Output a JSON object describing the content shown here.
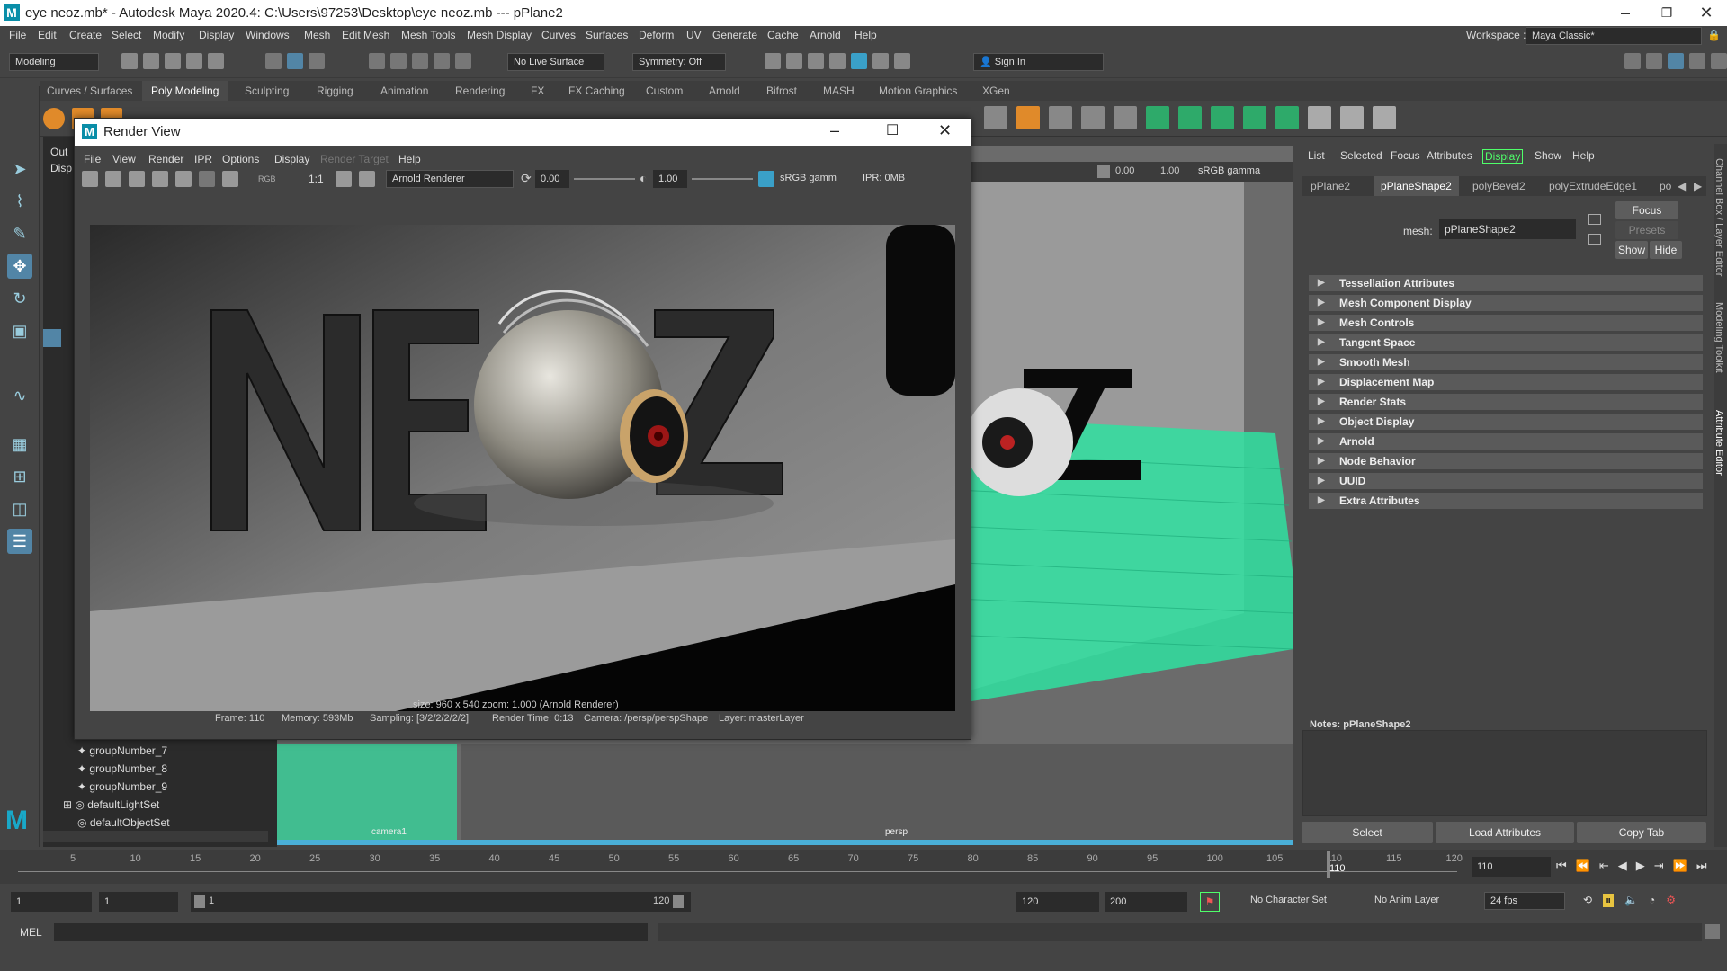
{
  "window": {
    "title": "eye neoz.mb* - Autodesk Maya 2020.4: C:\\Users\\97253\\Desktop\\eye neoz.mb   ---   pPlane2",
    "logo": "M"
  },
  "menubar": [
    "File",
    "Edit",
    "Create",
    "Select",
    "Modify",
    "Display",
    "Windows",
    "Mesh",
    "Edit Mesh",
    "Mesh Tools",
    "Mesh Display",
    "Curves",
    "Surfaces",
    "Deform",
    "UV",
    "Generate",
    "Cache",
    "Arnold",
    "Help"
  ],
  "workspace": {
    "label": "Workspace :",
    "value": "Maya Classic*"
  },
  "status": {
    "menuset": "Modeling",
    "live_surface": "No Live Surface",
    "symmetry": "Symmetry: Off",
    "sign_in": "Sign In"
  },
  "shelf_tabs": [
    "Curves / Surfaces",
    "Poly Modeling",
    "Sculpting",
    "Rigging",
    "Animation",
    "Rendering",
    "FX",
    "FX Caching",
    "Custom",
    "Arnold",
    "Bifrost",
    "MASH",
    "Motion Graphics",
    "XGen"
  ],
  "shelf_active": "Poly Modeling",
  "outliner": {
    "partial": [
      "Out",
      "Disp"
    ],
    "items": [
      "groupNumber_7",
      "groupNumber_8",
      "groupNumber_9",
      "defaultLightSet",
      "defaultObjectSet"
    ]
  },
  "viewport": {
    "exposure": "0.00",
    "gamma": "1.00",
    "colorspace": "sRGB gamma",
    "panes": [
      "camera1",
      "persp"
    ]
  },
  "render_view": {
    "title": "Render View",
    "menus": [
      "File",
      "View",
      "Render",
      "IPR",
      "Options",
      "Display",
      "Render Target",
      "Help"
    ],
    "ratio": "1:1",
    "renderer": "Arnold Renderer",
    "exposure": "0.00",
    "gamma": "1.00",
    "colorspace": "sRGB gamm",
    "ipr": "IPR: 0MB",
    "rgb": "RGB",
    "size_line": "size: 960 x 540  zoom: 1.000     (Arnold Renderer)",
    "stats": [
      "Frame: 110",
      "Memory: 593Mb",
      "Sampling: [3/2/2/2/2/2]",
      "Render Time: 0:13",
      "Camera: /persp/perspShape",
      "Layer: masterLayer"
    ],
    "text_letters": [
      "N",
      "E",
      "O",
      "Z"
    ]
  },
  "attribute_editor": {
    "menu": [
      "List",
      "Selected",
      "Focus",
      "Attributes",
      "Display",
      "Show",
      "Help"
    ],
    "tabs": [
      "pPlane2",
      "pPlaneShape2",
      "polyBevel2",
      "polyExtrudeEdge1",
      "po"
    ],
    "active_tab": "pPlaneShape2",
    "mesh_label": "mesh:",
    "mesh_value": "pPlaneShape2",
    "buttons": {
      "focus": "Focus",
      "presets": "Presets",
      "show": "Show",
      "hide": "Hide"
    },
    "sections": [
      "Tessellation Attributes",
      "Mesh Component Display",
      "Mesh Controls",
      "Tangent Space",
      "Smooth Mesh",
      "Displacement Map",
      "Render Stats",
      "Object Display",
      "Arnold",
      "Node Behavior",
      "UUID",
      "Extra Attributes"
    ],
    "notes_label": "Notes:  pPlaneShape2",
    "bottom_buttons": [
      "Select",
      "Load Attributes",
      "Copy Tab"
    ],
    "side_tabs": [
      "Channel Box / Layer Editor",
      "Modeling Toolkit",
      "Attribute Editor"
    ]
  },
  "timeline": {
    "ticks": [
      "5",
      "10",
      "15",
      "20",
      "25",
      "30",
      "35",
      "40",
      "45",
      "50",
      "55",
      "60",
      "65",
      "70",
      "75",
      "80",
      "85",
      "90",
      "95",
      "100",
      "105",
      "110",
      "115",
      "120"
    ],
    "current_frame": "110",
    "current_field": "110"
  },
  "range": {
    "start": "1",
    "start2": "1",
    "slider_start": "1",
    "slider_end": "120",
    "end": "120",
    "end2": "200",
    "character_set": "No Character Set",
    "anim_layer": "No Anim Layer",
    "fps": "24 fps"
  },
  "cmd": {
    "label": "MEL"
  }
}
